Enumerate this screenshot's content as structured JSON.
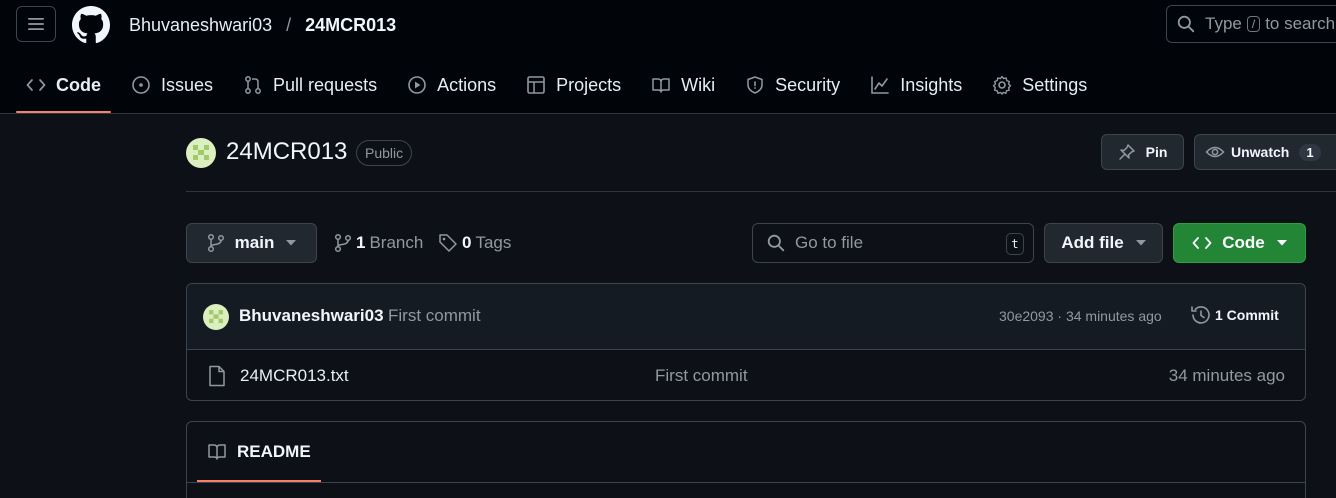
{
  "header": {
    "owner": "Bhuvaneshwari03",
    "separator": "/",
    "repo": "24MCR013",
    "search_prefix": "Type",
    "search_key": "/",
    "search_suffix": "to search"
  },
  "nav": {
    "tabs": [
      {
        "label": "Code",
        "icon": "code-icon",
        "active": true
      },
      {
        "label": "Issues",
        "icon": "issue-opened-icon"
      },
      {
        "label": "Pull requests",
        "icon": "git-pull-request-icon"
      },
      {
        "label": "Actions",
        "icon": "play-icon"
      },
      {
        "label": "Projects",
        "icon": "table-icon"
      },
      {
        "label": "Wiki",
        "icon": "book-icon"
      },
      {
        "label": "Security",
        "icon": "shield-icon"
      },
      {
        "label": "Insights",
        "icon": "graph-icon"
      },
      {
        "label": "Settings",
        "icon": "gear-icon"
      }
    ]
  },
  "repo": {
    "name": "24MCR013",
    "visibility": "Public",
    "pin_label": "Pin",
    "unwatch_label": "Unwatch",
    "watch_count": "1"
  },
  "toolbar": {
    "branch": "main",
    "branch_count": "1",
    "branch_label": "Branch",
    "tag_count": "0",
    "tag_label": "Tags",
    "goto_placeholder": "Go to file",
    "goto_key": "t",
    "add_file_label": "Add file",
    "code_label": "Code"
  },
  "commit": {
    "author": "Bhuvaneshwari03",
    "message": "First commit",
    "sha_time": "30e2093 · 34 minutes ago",
    "count_label": "1 Commit"
  },
  "files": [
    {
      "name": "24MCR013.txt",
      "commit": "First commit",
      "time": "34 minutes ago"
    }
  ],
  "readme": {
    "tab_label": "README"
  },
  "colors": {
    "background": "#0d1117",
    "header_bg": "#010409",
    "accent_underline": "#f78166",
    "code_button": "#238636",
    "avatar": "#dcefc0"
  }
}
